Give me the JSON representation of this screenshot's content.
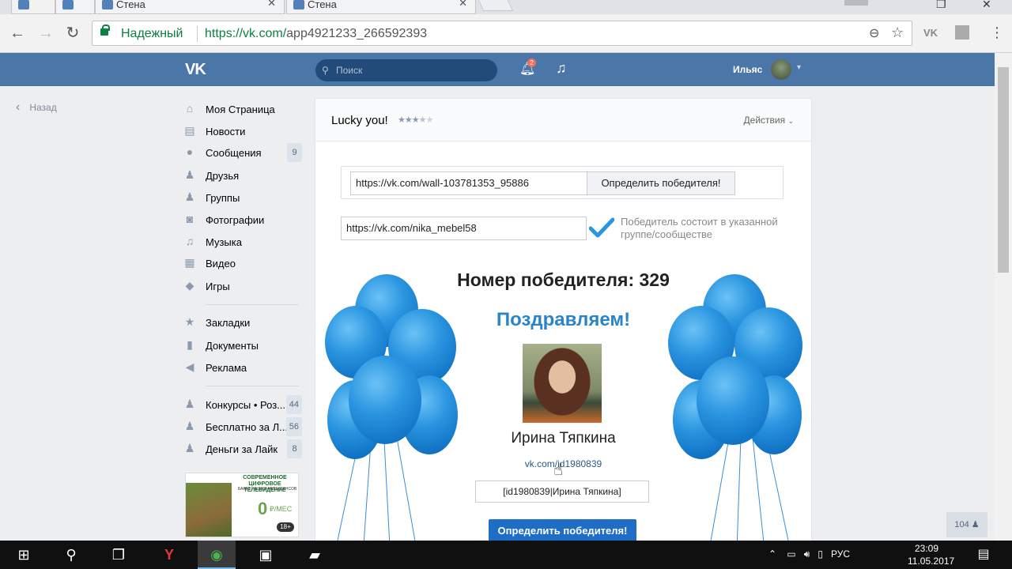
{
  "browser": {
    "tabs": [
      {
        "label": ""
      },
      {
        "label": "Стена"
      },
      {
        "label": "Стена"
      }
    ],
    "secure_label": "Надежный",
    "url_host": "https://vk.com/",
    "url_path": "app4921233_266592393"
  },
  "vk_header": {
    "logo": "VK",
    "search_placeholder": "Поиск",
    "notifications_count": "2",
    "user_name": "Ильяс"
  },
  "left": {
    "back_label": "Назад",
    "menu": [
      {
        "label": "Моя Страница",
        "icon": "home-icon",
        "count": ""
      },
      {
        "label": "Новости",
        "icon": "news-icon",
        "count": ""
      },
      {
        "label": "Сообщения",
        "icon": "messages-icon",
        "count": "9"
      },
      {
        "label": "Друзья",
        "icon": "friends-icon",
        "count": ""
      },
      {
        "label": "Группы",
        "icon": "groups-icon",
        "count": ""
      },
      {
        "label": "Фотографии",
        "icon": "camera-icon",
        "count": ""
      },
      {
        "label": "Музыка",
        "icon": "music-icon",
        "count": ""
      },
      {
        "label": "Видео",
        "icon": "video-icon",
        "count": ""
      },
      {
        "label": "Игры",
        "icon": "gamepad-icon",
        "count": ""
      }
    ],
    "menu2": [
      {
        "label": "Закладки",
        "icon": "star-icon"
      },
      {
        "label": "Документы",
        "icon": "document-icon"
      },
      {
        "label": "Реклама",
        "icon": "megaphone-icon"
      }
    ],
    "menu3": [
      {
        "label": "Конкурсы • Роз...",
        "count": "44"
      },
      {
        "label": "Бесплатно за Л...",
        "count": "56"
      },
      {
        "label": "Деньги за Лайк",
        "count": "8"
      }
    ],
    "ad": {
      "title": "СОВРЕМЕННОЕ ЦИФРОВОЕ ТЕЛЕВИДЕНИЕ",
      "subtitle": "БАКЕТ НА 3000 МИНИСАНСОВ",
      "price": "0",
      "currency": "₽/МЕС",
      "age": "18+"
    }
  },
  "app": {
    "title": "Lucky you!",
    "rating": 3.5,
    "actions_label": "Действия",
    "post_url": "https://vk.com/wall-103781353_95886",
    "determine_label": "Определить победителя!",
    "group_url": "https://vk.com/nika_mebel58",
    "group_note": "Победитель состоит в указанной группе/сообществе",
    "winner_number_label": "Номер победителя: 329",
    "congrats": "Поздравляем!",
    "winner_name": "Ирина Тяпкина",
    "winner_link": "vk.com/id1980839",
    "winner_code": "[id1980839|Ирина Тяпкина]",
    "determine_label_2": "Определить победителя!"
  },
  "counter": "104",
  "taskbar": {
    "lang": "РУС",
    "time": "23:09",
    "date": "11.05.2017"
  },
  "colors": {
    "vk_blue": "#4a76a8",
    "button_blue": "#1e6ec8",
    "congrats_blue": "#2a84c9",
    "secure_green": "#0b8043"
  }
}
